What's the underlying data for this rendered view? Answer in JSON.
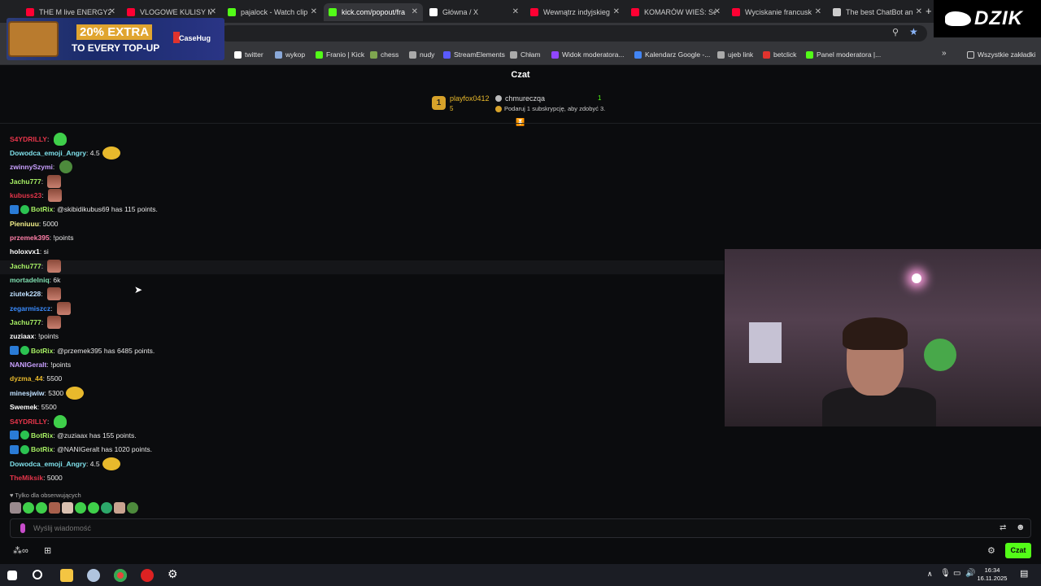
{
  "tabs": [
    {
      "title": "THE M live ENERGY2",
      "color": "#ff0033",
      "active": false
    },
    {
      "title": "VLOGOWE KULISY M",
      "color": "#ff0033",
      "active": false
    },
    {
      "title": "pajalock - Watch clip",
      "color": "#53fc18",
      "active": false
    },
    {
      "title": "kick.com/popout/fra",
      "color": "#53fc18",
      "active": true
    },
    {
      "title": "Główna / X",
      "color": "#ffffff",
      "active": false
    },
    {
      "title": "Wewnątrz indyjskieg",
      "color": "#ff0033",
      "active": false
    },
    {
      "title": "KOMARÓW WIEŚ: Sel",
      "color": "#ff0033",
      "active": false
    },
    {
      "title": "Wyciskanie francusk",
      "color": "#ff0033",
      "active": false
    },
    {
      "title": "The best ChatBot an",
      "color": "#cccccc",
      "active": false
    }
  ],
  "bookmarks": [
    {
      "label": "twitter",
      "color": "#ffffff"
    },
    {
      "label": "wykop",
      "color": "#8aa8d8"
    },
    {
      "label": "Franio | Kick",
      "color": "#53fc18"
    },
    {
      "label": "chess",
      "color": "#7fa650"
    },
    {
      "label": "nudy",
      "color": "#aaaaaa"
    },
    {
      "label": "StreamElements",
      "color": "#5a5aff"
    },
    {
      "label": "Chłam",
      "color": "#aaaaaa"
    },
    {
      "label": "Widok moderatora...",
      "color": "#9146ff"
    },
    {
      "label": "Kalendarz Google -...",
      "color": "#4285f4"
    },
    {
      "label": "ujeb link",
      "color": "#aaaaaa"
    },
    {
      "label": "betclick",
      "color": "#e0332e"
    },
    {
      "label": "Panel moderatora |...",
      "color": "#53fc18"
    }
  ],
  "all_bookmarks": "Wszystkie zakładki",
  "promo": {
    "line1": "20% EXTRA",
    "line2": "TO EVERY TOP-UP",
    "brand": "CaseHug"
  },
  "logo_text": "DZIK",
  "chat_title": "Czat",
  "header": {
    "rank": "1",
    "leader_name": "playfox0412",
    "leader_count": "5",
    "second_name": "chmureczqa",
    "second_count": "1",
    "gift_hint": "Podaruj 1 subskrypcję, aby zdobyć 3."
  },
  "messages": [
    {
      "user": "S4YDRILLY",
      "color": "#e5354a",
      "text": "",
      "emote": "green"
    },
    {
      "user": "Dowodca_emoji_Angry",
      "color": "#7fe0ea",
      "text": "4.5",
      "emote": "yellow"
    },
    {
      "user": "zwinnySzymi",
      "color": "#c9a0ff",
      "text": "",
      "emote": "pepe"
    },
    {
      "user": "Jachu777",
      "color": "#a7f064",
      "text": "",
      "emote": "photo"
    },
    {
      "user": "kubuss23",
      "color": "#e5354a",
      "text": "",
      "emote": "photo"
    },
    {
      "user": "BotRix",
      "color": "#a7f064",
      "text": "@skibidikubus69 has 115 points.",
      "emote": "",
      "bot": true
    },
    {
      "user": "Pieniuuu",
      "color": "#f3f08a",
      "text": "5000",
      "emote": ""
    },
    {
      "user": "przemek395",
      "color": "#ff7fa8",
      "text": "!points",
      "emote": ""
    },
    {
      "user": "holoxvx1",
      "color": "#ffffff",
      "text": "si",
      "emote": ""
    },
    {
      "user": "Jachu777",
      "color": "#a7f064",
      "text": "",
      "emote": "photo"
    },
    {
      "user": "mortadelniq",
      "color": "#7fe0b0",
      "text": "6k",
      "emote": ""
    },
    {
      "user": "ziutek228",
      "color": "#bfe0ff",
      "text": "",
      "emote": "photo"
    },
    {
      "user": "zegarmiszcz",
      "color": "#3a8cff",
      "text": "",
      "emote": "photo"
    },
    {
      "user": "Jachu777",
      "color": "#a7f064",
      "text": "",
      "emote": "photo"
    },
    {
      "user": "zuziaax",
      "color": "#ffffff",
      "text": "!points",
      "emote": ""
    },
    {
      "user": "BotRix",
      "color": "#a7f064",
      "text": "@przemek395 has 6485 points.",
      "emote": "",
      "bot": true
    },
    {
      "user": "NANIGeralt",
      "color": "#c9a0ff",
      "text": "!points",
      "emote": ""
    },
    {
      "user": "dyzma_44",
      "color": "#e8b92c",
      "text": "5500",
      "emote": ""
    },
    {
      "user": "minesjwiw",
      "color": "#bfe0ff",
      "text": "5300",
      "emote": "yellow"
    },
    {
      "user": "Swemek",
      "color": "#ffffff",
      "text": "5500",
      "emote": ""
    },
    {
      "user": "S4YDRILLY",
      "color": "#e5354a",
      "text": "",
      "emote": "green"
    },
    {
      "user": "BotRix",
      "color": "#a7f064",
      "text": "@zuziaax has 155 points.",
      "emote": "",
      "bot": true
    },
    {
      "user": "BotRix",
      "color": "#a7f064",
      "text": "@NANIGeralt has 1020 points.",
      "emote": "",
      "bot": true
    },
    {
      "user": "Dowodca_emoji_Angry",
      "color": "#7fe0ea",
      "text": "4.5",
      "emote": "yellow"
    },
    {
      "user": "TheMiksik",
      "color": "#e5354a",
      "text": "5000",
      "emote": ""
    }
  ],
  "followers_only": "Tylko dla obserwujących",
  "input_placeholder": "Wyślij wiadomość",
  "send_label": "Czat",
  "clock": {
    "time": "16:34",
    "date": "16.11.2025"
  }
}
